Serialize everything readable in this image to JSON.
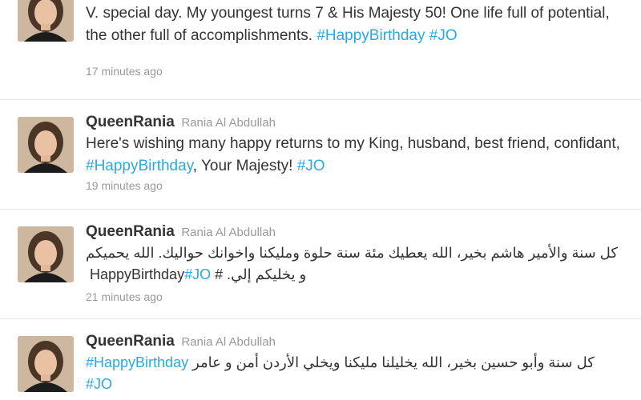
{
  "tweets": [
    {
      "screen_name": "",
      "full_name": "",
      "text_parts": [
        {
          "text": "V. special day. My youngest turns 7 & His Majesty 50! One life full of potential, the other full of accomplishments.  "
        },
        {
          "text": "#HappyBirthday"
        },
        {
          "text": " "
        },
        {
          "text": "#JO"
        }
      ],
      "time": "17 minutes ago"
    },
    {
      "screen_name": "QueenRania",
      "full_name": "Rania Al Abdullah",
      "text_parts": [
        {
          "text": "Here's wishing many happy returns to my King, husband, best friend, confidant, "
        },
        {
          "text": "#HappyBirthday"
        },
        {
          "text": ", Your Majesty! "
        },
        {
          "text": "#JO"
        }
      ],
      "time": "19 minutes ago"
    },
    {
      "screen_name": "QueenRania",
      "full_name": "Rania Al Abdullah",
      "text_parts": [
        {
          "text": "كل سنة والأمير  هاشم بخير، الله يعطيك مئة سنة حلوة ومليكنا واخوانك حواليك. الله يحميكم و يخليكم إلي. "
        },
        {
          "text": "# "
        },
        {
          "text": "#JO"
        },
        {
          "text": " HappyBirthday"
        }
      ],
      "time": "21 minutes ago"
    },
    {
      "screen_name": "QueenRania",
      "full_name": "Rania Al Abdullah",
      "text_parts": [
        {
          "text": "كل سنة وأبو حسين بخير، الله يخليلنا مليكنا ويخلي الأردن أمن و عامر "
        },
        {
          "text": "#HappyBirthday"
        },
        {
          "text": " "
        },
        {
          "text": "#JO"
        }
      ],
      "time": ""
    }
  ],
  "colors": {
    "hashtag": "#2aa9e0",
    "text": "#333333",
    "meta": "#999999",
    "divider": "#e6e6e6"
  },
  "icons": {
    "avatar": "profile-photo"
  }
}
